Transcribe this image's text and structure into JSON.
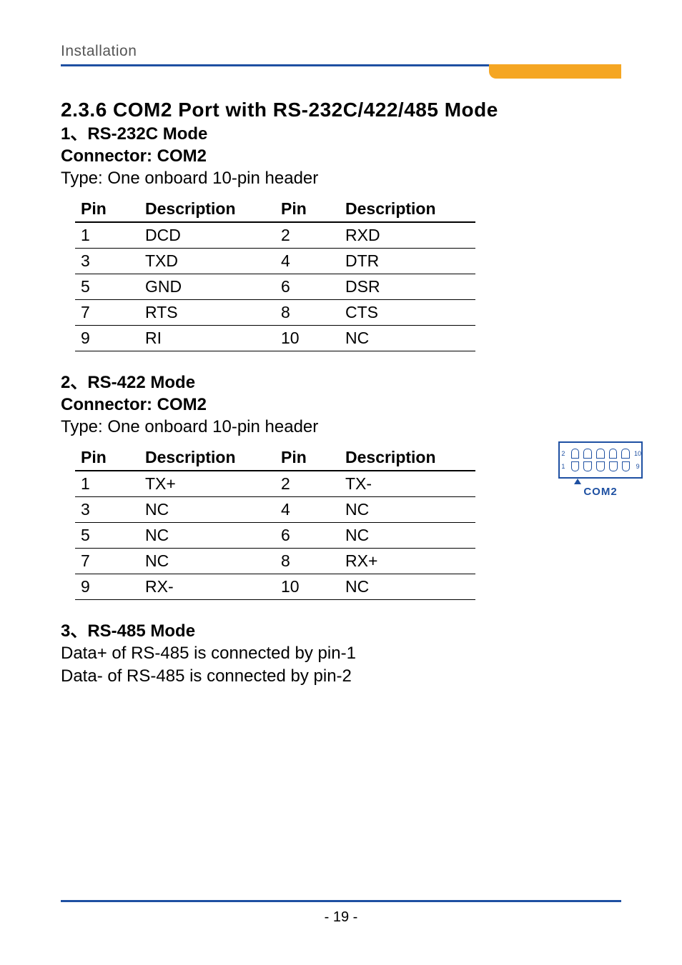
{
  "header": {
    "section_label": "Installation"
  },
  "section_heading": "2.3.6 COM2 Port with RS-232C/422/485 Mode",
  "mode1": {
    "title": "1、RS-232C Mode",
    "connector": "Connector: COM2",
    "type": "Type: One onboard 10-pin header",
    "headers": [
      "Pin",
      "Description",
      "Pin",
      "Description"
    ],
    "rows": [
      [
        "1",
        "DCD",
        "2",
        "RXD"
      ],
      [
        "3",
        "TXD",
        "4",
        "DTR"
      ],
      [
        "5",
        "GND",
        "6",
        "DSR"
      ],
      [
        "7",
        "RTS",
        "8",
        "CTS"
      ],
      [
        "9",
        "RI",
        "10",
        "NC"
      ]
    ]
  },
  "mode2": {
    "title": "2、RS-422 Mode",
    "connector": "Connector: COM2",
    "type": "Type: One onboard 10-pin header",
    "headers": [
      "Pin",
      "Description",
      "Pin",
      "Description"
    ],
    "rows": [
      [
        "1",
        "TX+",
        "2",
        "TX-"
      ],
      [
        "3",
        "NC",
        "4",
        "NC"
      ],
      [
        "5",
        "NC",
        "6",
        "NC"
      ],
      [
        "7",
        "NC",
        "8",
        "RX+"
      ],
      [
        "9",
        "RX-",
        "10",
        "NC"
      ]
    ]
  },
  "mode3": {
    "title": "3、RS-485 Mode",
    "line1": "Data+ of RS-485 is connected by pin-1",
    "line2": "Data- of RS-485 is connected by pin-2"
  },
  "diagram": {
    "label": "COM2",
    "top_left_num": "2",
    "top_right_num": "10",
    "bottom_left_num": "1",
    "bottom_right_num": "9"
  },
  "footer": {
    "page": "- 19 -"
  }
}
